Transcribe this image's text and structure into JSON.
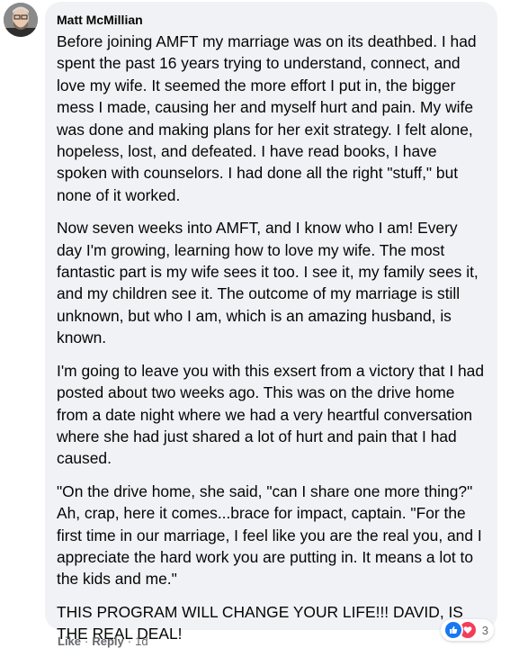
{
  "comment": {
    "author": "Matt McMillian",
    "paragraphs": [
      "Before joining AMFT my marriage was on its deathbed. I had spent the past 16 years trying to understand, connect, and love my wife. It seemed the more effort I put in, the bigger mess I made, causing her and myself hurt and pain. My wife was done and making plans for her exit strategy. I felt alone, hopeless, lost, and defeated. I have read books, I have spoken with counselors. I had done all the right \"stuff,\" but none of it worked.",
      "Now seven weeks into AMFT, and I know who I am! Every day I'm growing, learning how to love my wife. The most fantastic part is my wife sees it too. I see it, my family sees it, and my children see it. The outcome of my marriage is still unknown, but who I am, which is an amazing husband, is known.",
      "I'm going to leave you with this exsert from a victory that I had posted about two weeks ago. This was on the drive home from a date night where we had a very heartful conversation where she had just shared a lot of hurt and pain that I had caused.",
      "\"On the drive home, she said, \"can I share one more thing?\" Ah, crap, here it comes...brace for impact, captain. \"For the first time in our marriage, I feel like you are the real you, and I appreciate the hard work you are putting in. It means a lot to the kids and me.\"",
      "THIS PROGRAM WILL CHANGE YOUR LIFE!!! DAVID, IS THE REAL DEAL!"
    ],
    "reactions": {
      "icons": [
        "like-icon",
        "love-icon"
      ],
      "count": "3"
    },
    "actions": {
      "like": "Like",
      "reply": "Reply",
      "separator": "·",
      "time": "1d"
    }
  },
  "colors": {
    "bubble": "#f0f2f5",
    "secondary_text": "#65676b",
    "like_blue": "#1877f2",
    "love_red": "#f33e58"
  }
}
